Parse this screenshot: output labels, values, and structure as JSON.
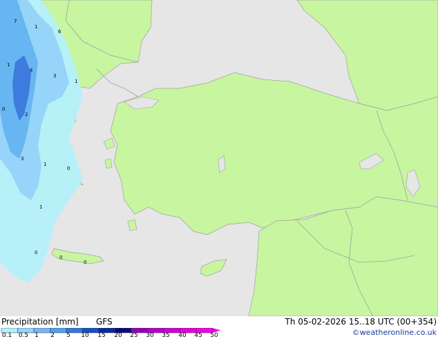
{
  "legend": {
    "title": "Precipitation [mm]",
    "model": "GFS",
    "datetime": "Th 05-02-2026 15..18 UTC (00+354)",
    "credit": "©weatheronline.co.uk",
    "scale_labels": [
      "0.1",
      "0.5",
      "1",
      "2",
      "5",
      "10",
      "15",
      "20",
      "25",
      "30",
      "35",
      "40",
      "45",
      "50"
    ],
    "scale_colors": [
      "#b4f0fa",
      "#96d2fa",
      "#78b4fa",
      "#50a0f0",
      "#3278dc",
      "#1450c8",
      "#0a28a0",
      "#0a0a78",
      "#9600b4",
      "#b400c8",
      "#d200d2",
      "#e600dc",
      "#f000e6"
    ]
  },
  "colors": {
    "sea": "#e6e6e6",
    "land": "#c8f5a0",
    "border": "#a0a0a0",
    "precip_light": "#b4f0fa",
    "precip_mid": "#96d2fa",
    "precip_blue": "#64b4f0",
    "precip_dark": "#3c78dc"
  },
  "map_labels": [
    "7",
    "1",
    "6",
    "1",
    "4",
    "3",
    "1",
    "0",
    "2",
    "3",
    "1",
    "0",
    "1",
    "0",
    "0",
    "0"
  ]
}
